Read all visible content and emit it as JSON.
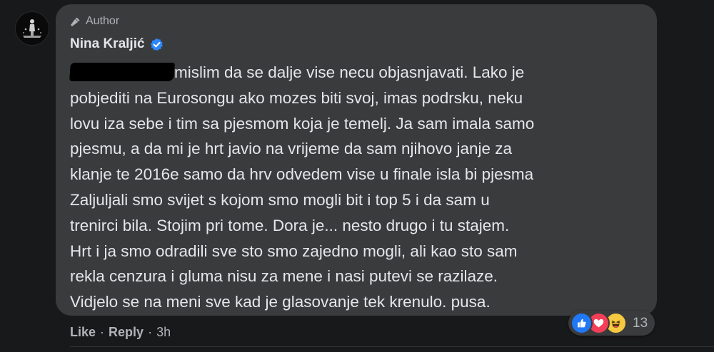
{
  "comment": {
    "badge": "Author",
    "author": "Nina Kraljić",
    "verified": true,
    "redacted_prefix": true,
    "lines": [
      "mislim da se dalje vise necu objasnjavati. Lako je",
      "pobjediti na Eurosongu ako mozes biti svoj, imas podrsku, neku",
      "lovu iza sebe i tim sa pjesmom koja je temelj. Ja sam imala samo",
      "pjesmu, a da mi je hrt javio na vrijeme da sam njihovo janje za",
      "klanje te 2016e samo da hrv odvedem vise u finale isla bi pjesma",
      "Zaljuljali smo svijet s kojom smo mogli bit i top 5 i da sam u",
      "trenirci bila. Stojim pri tome. Dora je... nesto drugo i tu stajem.",
      "Hrt i ja smo odradili sve sto smo zajedno mogli, ali kao sto sam",
      "rekla cenzura i gluma nisu za mene i nasi putevi se razilaze.",
      "Vidjelo se na meni sve kad je glasovanje tek krenulo. pusa."
    ],
    "reactions": {
      "icons": [
        "like-icon",
        "love-icon",
        "haha-icon"
      ],
      "count": "13"
    },
    "actions": {
      "like": "Like",
      "reply": "Reply",
      "separator": "·",
      "time": "3h"
    }
  },
  "colors": {
    "page_bg": "#18191a",
    "bubble_bg": "#3a3b3c",
    "text_primary": "#e4e6eb",
    "text_secondary": "#b0b3b8",
    "verified_blue": "#2d88ff",
    "like_blue": "#2078f4",
    "love_red": "#f33e58",
    "haha_yellow": "#f7c940"
  }
}
